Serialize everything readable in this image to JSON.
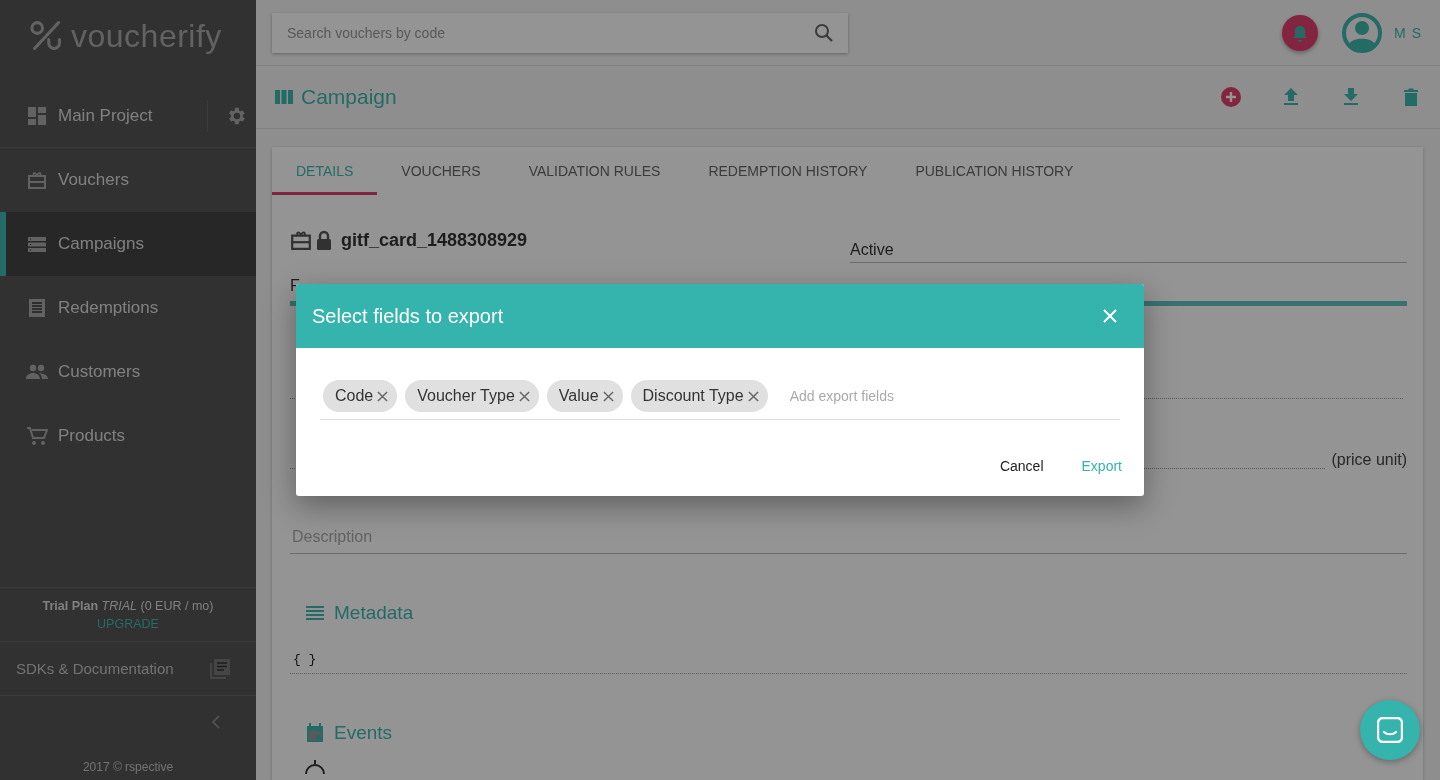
{
  "sidebar": {
    "logo": "voucherify",
    "project": "Main Project",
    "nav": [
      {
        "label": "Vouchers",
        "selected": false
      },
      {
        "label": "Campaigns",
        "selected": true
      },
      {
        "label": "Redemptions",
        "selected": false
      },
      {
        "label": "Customers",
        "selected": false
      },
      {
        "label": "Products",
        "selected": false
      }
    ],
    "plan": {
      "name": "Trial Plan",
      "tier": "TRIAL",
      "price": "(0 EUR / mo)",
      "upgrade": "UPGRADE"
    },
    "docs": "SDKs & Documentation",
    "footer": "2017 © rspective"
  },
  "topbar": {
    "search": {
      "placeholder": "Search vouchers by code"
    },
    "user": "M S"
  },
  "page": {
    "title": "Campaign"
  },
  "tabs": [
    {
      "label": "DETAILS",
      "selected": true
    },
    {
      "label": "VOUCHERS",
      "selected": false
    },
    {
      "label": "VALIDATION RULES",
      "selected": false
    },
    {
      "label": "REDEMPTION HISTORY",
      "selected": false
    },
    {
      "label": "PUBLICATION HISTORY",
      "selected": false
    }
  ],
  "campaign": {
    "name": "gitf_card_1488308929",
    "status": "Active",
    "label_fragment": "F",
    "unit": "(price unit)",
    "description_placeholder": "Description",
    "metadata_heading": "Metadata",
    "metadata": "{ }",
    "events_heading": "Events"
  },
  "dialog": {
    "title": "Select fields to export",
    "chips": [
      "Code",
      "Voucher Type",
      "Value",
      "Discount Type"
    ],
    "placeholder": "Add export fields",
    "buttons": [
      {
        "label": "Cancel",
        "kind": "plain"
      },
      {
        "label": "Export",
        "kind": "primary"
      }
    ]
  }
}
